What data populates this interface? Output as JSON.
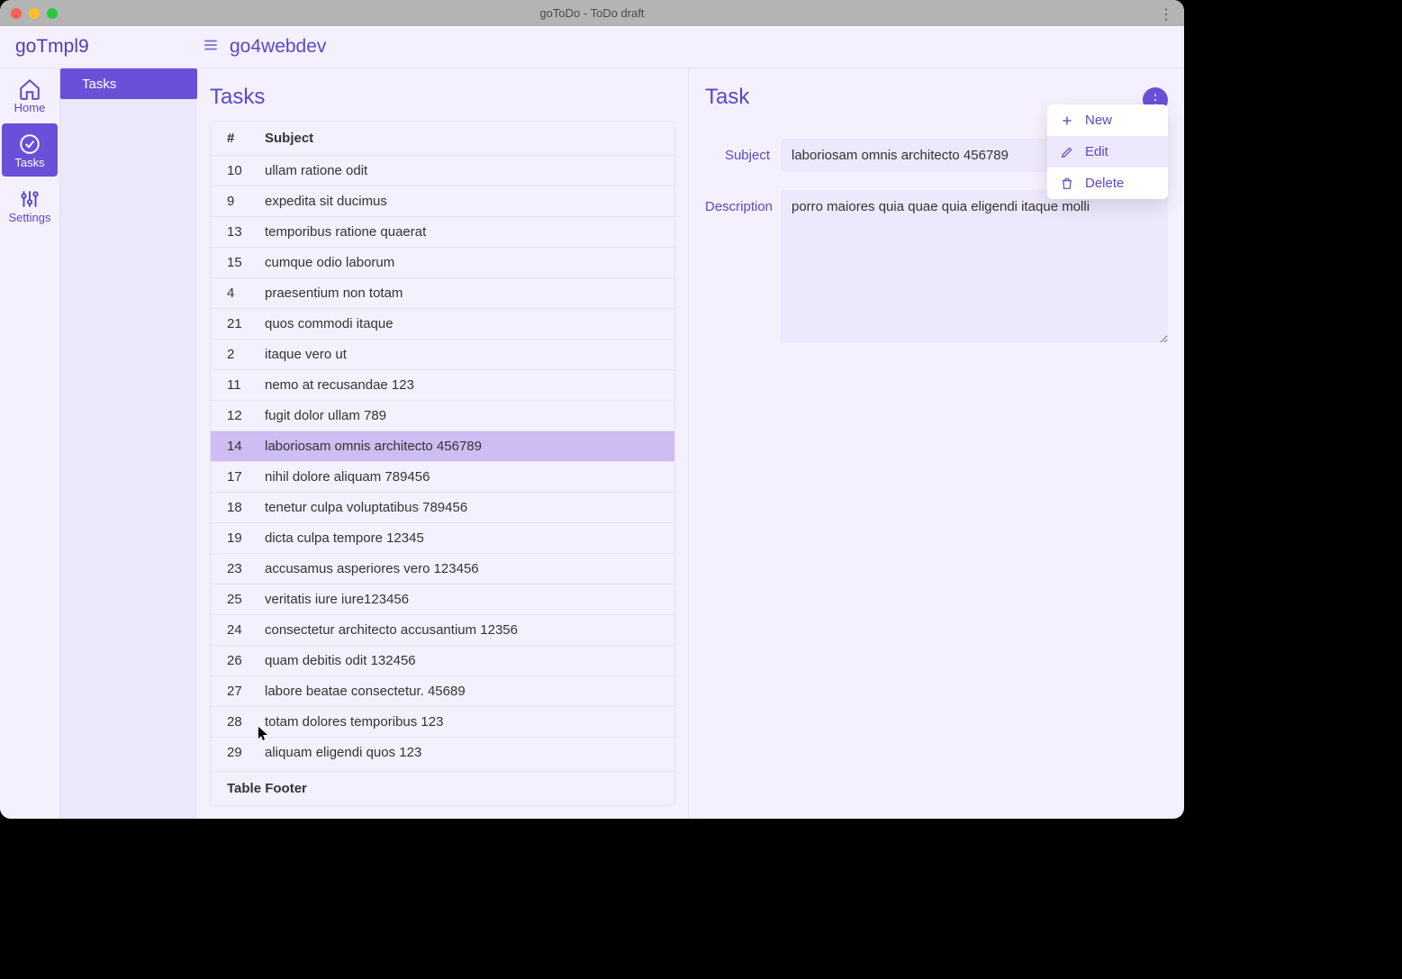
{
  "window": {
    "title": "goToDo - ToDo draft"
  },
  "brand": "goTmpl9",
  "breadcrumb": "go4webdev",
  "rail": {
    "home": "Home",
    "tasks": "Tasks",
    "settings": "Settings"
  },
  "side": {
    "tasks": "Tasks"
  },
  "tasks_title": "Tasks",
  "table": {
    "col_num": "#",
    "col_subject": "Subject",
    "footer": "Table Footer",
    "selected_id": "14",
    "rows": [
      {
        "id": "10",
        "subject": "ullam ratione odit"
      },
      {
        "id": "9",
        "subject": "expedita sit ducimus"
      },
      {
        "id": "13",
        "subject": "temporibus ratione quaerat"
      },
      {
        "id": "15",
        "subject": "cumque odio laborum"
      },
      {
        "id": "4",
        "subject": "praesentium non totam"
      },
      {
        "id": "21",
        "subject": "quos commodi itaque"
      },
      {
        "id": "2",
        "subject": "itaque vero ut"
      },
      {
        "id": "11",
        "subject": "nemo at recusandae 123"
      },
      {
        "id": "12",
        "subject": "fugit dolor ullam 789"
      },
      {
        "id": "14",
        "subject": "laboriosam omnis architecto 456789"
      },
      {
        "id": "17",
        "subject": "nihil dolore aliquam 789456"
      },
      {
        "id": "18",
        "subject": "tenetur culpa voluptatibus 789456"
      },
      {
        "id": "19",
        "subject": "dicta culpa tempore 12345"
      },
      {
        "id": "23",
        "subject": "accusamus asperiores vero 123456"
      },
      {
        "id": "25",
        "subject": "veritatis iure iure123456"
      },
      {
        "id": "24",
        "subject": "consectetur architecto accusantium 12356"
      },
      {
        "id": "26",
        "subject": "quam debitis odit 132456"
      },
      {
        "id": "27",
        "subject": "labore beatae consectetur. 45689"
      },
      {
        "id": "28",
        "subject": "totam dolores temporibus 123"
      },
      {
        "id": "29",
        "subject": "aliquam eligendi quos 123"
      }
    ]
  },
  "detail": {
    "title": "Task",
    "subject_label": "Subject",
    "description_label": "Description",
    "subject": "laboriosam omnis architecto 456789",
    "description": "porro maiores quia quae quia eligendi itaque molli"
  },
  "menu": {
    "new": "New",
    "edit": "Edit",
    "delete": "Delete"
  }
}
